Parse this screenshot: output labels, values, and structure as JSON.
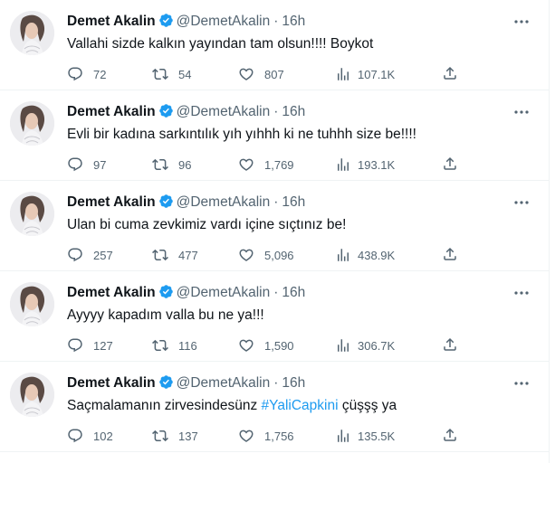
{
  "colors": {
    "text": "#0f1419",
    "muted": "#536471",
    "accent": "#1d9bf0",
    "divider": "#eff3f4"
  },
  "icons": {
    "verified": "verified-badge-icon",
    "more": "more-options-icon",
    "reply": "reply-icon",
    "retweet": "retweet-icon",
    "like": "heart-icon",
    "views": "views-chart-icon",
    "share": "share-icon"
  },
  "tweets": [
    {
      "author": "Demet Akalin",
      "handle": "@DemetAkalin",
      "separator": "·",
      "time": "16h",
      "text": "Vallahi sizde kalkın yayından tam olsun!!!! Boykot",
      "text_before": "",
      "hashtag": "",
      "text_after": "",
      "replies": "72",
      "retweets": "54",
      "likes": "807",
      "views": "107.1K"
    },
    {
      "author": "Demet Akalin",
      "handle": "@DemetAkalin",
      "separator": "·",
      "time": "16h",
      "text": "Evli bir kadına sarkıntılık yıh yıhhh ki ne tuhhh size be!!!!",
      "text_before": "",
      "hashtag": "",
      "text_after": "",
      "replies": "97",
      "retweets": "96",
      "likes": "1,769",
      "views": "193.1K"
    },
    {
      "author": "Demet Akalin",
      "handle": "@DemetAkalin",
      "separator": "·",
      "time": "16h",
      "text": "Ulan bi cuma zevkimiz vardı içine sıçtınız be!",
      "text_before": "",
      "hashtag": "",
      "text_after": "",
      "replies": "257",
      "retweets": "477",
      "likes": "5,096",
      "views": "438.9K"
    },
    {
      "author": "Demet Akalin",
      "handle": "@DemetAkalin",
      "separator": "·",
      "time": "16h",
      "text": "Ayyyy kapadım valla bu ne ya!!!",
      "text_before": "",
      "hashtag": "",
      "text_after": "",
      "replies": "127",
      "retweets": "116",
      "likes": "1,590",
      "views": "306.7K"
    },
    {
      "author": "Demet Akalin",
      "handle": "@DemetAkalin",
      "separator": "·",
      "time": "16h",
      "text": "",
      "text_before": "Saçmalamanın zirvesindesünz ",
      "hashtag": "#YaliCapkini",
      "text_after": " çüşşş ya",
      "replies": "102",
      "retweets": "137",
      "likes": "1,756",
      "views": "135.5K"
    }
  ]
}
